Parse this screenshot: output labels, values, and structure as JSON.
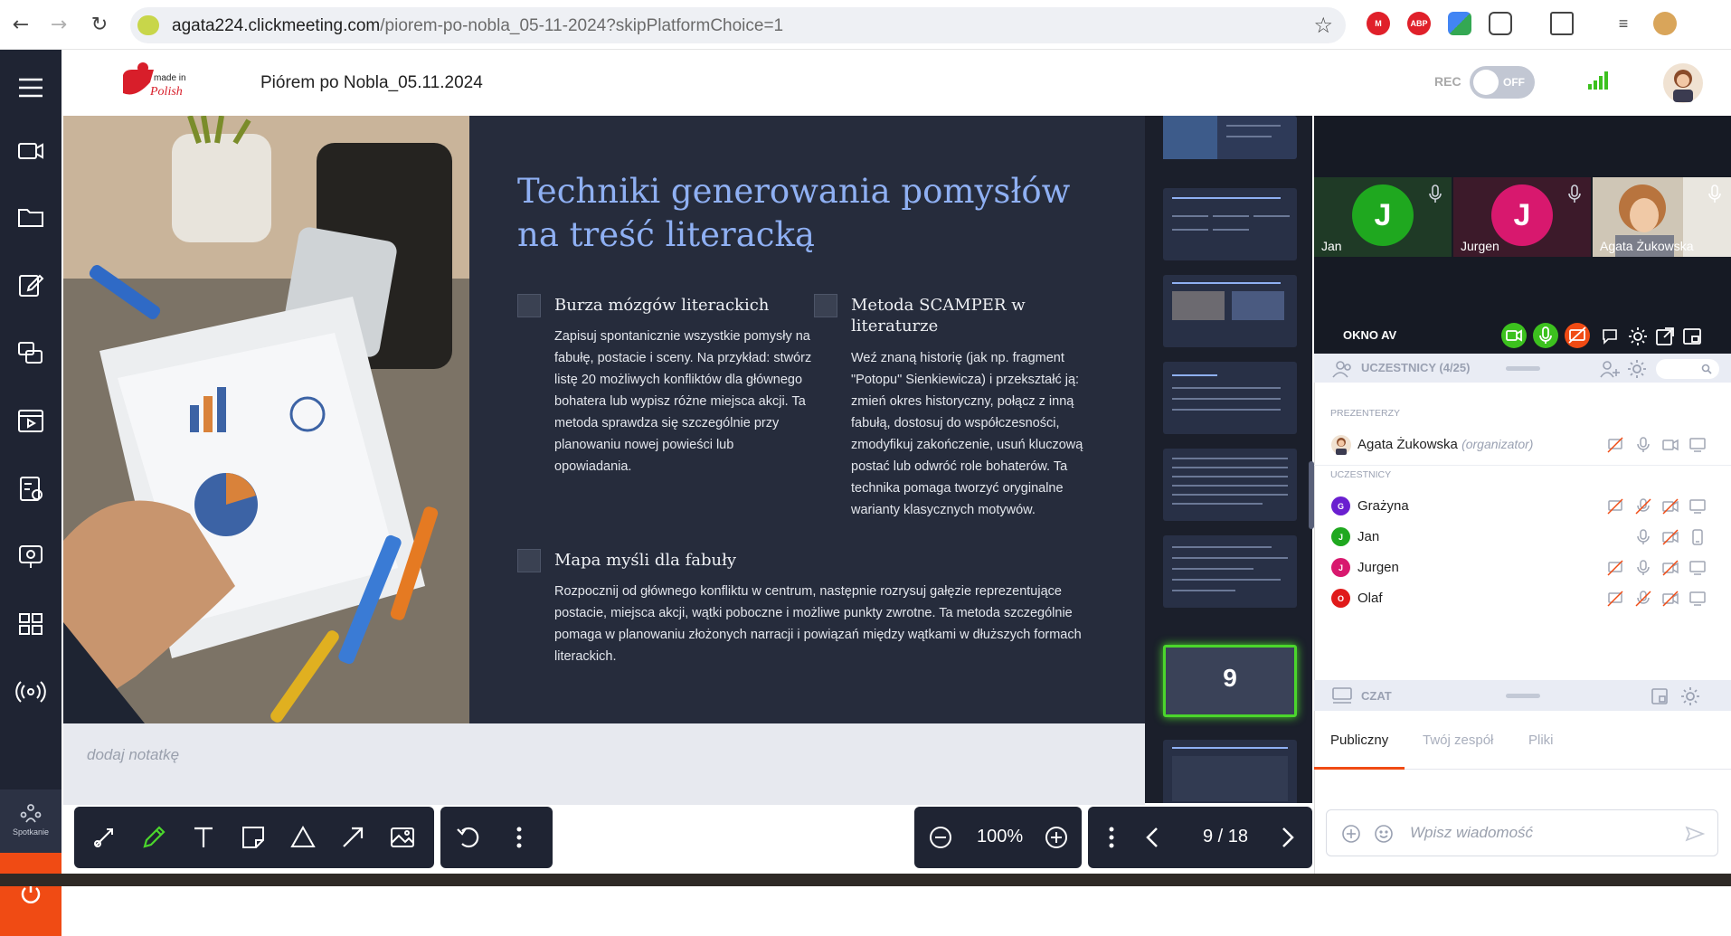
{
  "browser": {
    "url_domain": "agata224.clickmeeting.com",
    "url_path": "/piorem-po-nobla_05-11-2024?skipPlatformChoice=1",
    "extensions": [
      "ABP"
    ]
  },
  "app": {
    "logo_text": "made in Polish",
    "meeting_title": "Piórem po Nobla_05.11.2024",
    "rec_label": "REC",
    "rec_state": "OFF",
    "sidebar_bottom_label": "Spotkanie"
  },
  "slide": {
    "heading": "Techniki generowania pomysłów na treść literacką",
    "sections": [
      {
        "title": "Burza mózgów literackich",
        "body": "Zapisuj spontanicznie wszystkie pomysły na fabułę, postacie i sceny. Na przykład: stwórz listę 20 możliwych konfliktów dla głównego bohatera lub wypisz różne miejsca akcji. Ta metoda sprawdza się szczególnie przy planowaniu nowej powieści lub opowiadania."
      },
      {
        "title": "Metoda SCAMPER w literaturze",
        "body": "Weź znaną historię (jak np. fragment \"Potopu\" Sienkiewicza) i przekształć ją: zmień okres historyczny, połącz z inną fabułą, dostosuj do współczesności, zmodyfikuj zakończenie, usuń kluczową postać lub odwróć role bohaterów. Ta technika pomaga tworzyć oryginalne warianty klasycznych motywów."
      },
      {
        "title": "Mapa myśli dla fabuły",
        "body": "Rozpocznij od głównego konfliktu w centrum, następnie rozrysuj gałęzie reprezentujące postacie, miejsca akcji, wątki poboczne i możliwe punkty zwrotne. Ta metoda szczególnie pomaga w planowaniu złożonych narracji i powiązań między wątkami w dłuższych formach literackich."
      }
    ]
  },
  "notes": {
    "placeholder": "dodaj notatkę"
  },
  "thumbnails": {
    "active_number": "9"
  },
  "toolbar": {
    "zoom": "100%",
    "page": "9 / 18"
  },
  "video": {
    "tiles": [
      {
        "initial": "J",
        "name": "Jan",
        "color": "#1fa81f"
      },
      {
        "initial": "J",
        "name": "Jurgen",
        "color": "#d8186e"
      },
      {
        "initial": "",
        "name": "Agata Żukowska",
        "color": "#c9b29c"
      }
    ],
    "av_window_label": "OKNO AV"
  },
  "participants": {
    "title": "UCZESTNICY (4/25)",
    "presenters_label": "PREZENTERZY",
    "attendees_label": "UCZESTNICY",
    "presenters": [
      {
        "name": "Agata Żukowska",
        "role": "(organizator)"
      }
    ],
    "attendees": [
      {
        "initial": "G",
        "name": "Grażyna",
        "color": "#6a1fd0"
      },
      {
        "initial": "J",
        "name": "Jan",
        "color": "#1fa81f"
      },
      {
        "initial": "J",
        "name": "Jurgen",
        "color": "#d8186e"
      },
      {
        "initial": "O",
        "name": "Olaf",
        "color": "#e01a1a"
      }
    ]
  },
  "chat": {
    "title": "CZAT",
    "tabs": [
      "Publiczny",
      "Twój zespół",
      "Pliki"
    ],
    "active_tab": "Publiczny",
    "placeholder": "Wpisz wiadomość"
  },
  "colors": {
    "accent": "#f04b14",
    "sidebar": "#1f2433",
    "slide_bg": "#262c3c",
    "heading": "#8fb0f3",
    "active_thumb": "#4bd62c"
  }
}
